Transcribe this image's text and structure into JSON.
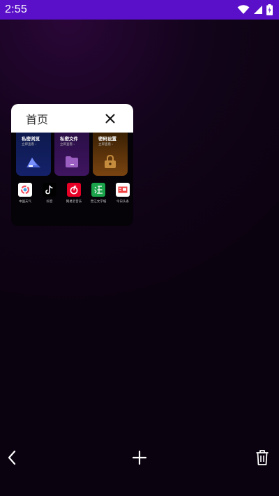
{
  "status_bar": {
    "time": "2:55",
    "icons": [
      "wifi-icon",
      "signal-icon",
      "battery-icon"
    ]
  },
  "tab_card": {
    "title": "首页",
    "close_icon": "close-icon",
    "features": [
      {
        "title": "私密浏览",
        "subtitle": "立即查看 ›",
        "icon": "private-browse-icon"
      },
      {
        "title": "私密文件",
        "subtitle": "立即查看 ›",
        "icon": "folder-icon"
      },
      {
        "title": "密码设置",
        "subtitle": "立即查看 ›",
        "icon": "lock-icon"
      }
    ],
    "apps": [
      {
        "label": "中国天气",
        "icon": "weather-app-icon"
      },
      {
        "label": "抖音",
        "icon": "douyin-app-icon"
      },
      {
        "label": "网易云音乐",
        "icon": "netease-music-app-icon"
      },
      {
        "label": "晋江文学城",
        "icon": "jinjiang-app-icon"
      },
      {
        "label": "今日头条",
        "icon": "toutiao-app-icon"
      }
    ],
    "add_shortcut_icon": "plus-icon"
  },
  "bottom_bar": {
    "back_icon": "back-icon",
    "new_tab_icon": "plus-icon",
    "delete_icon": "trash-icon"
  },
  "colors": {
    "status_bar": "#5a10c8",
    "background": "#0a020e",
    "card_header": "#ffffff"
  }
}
